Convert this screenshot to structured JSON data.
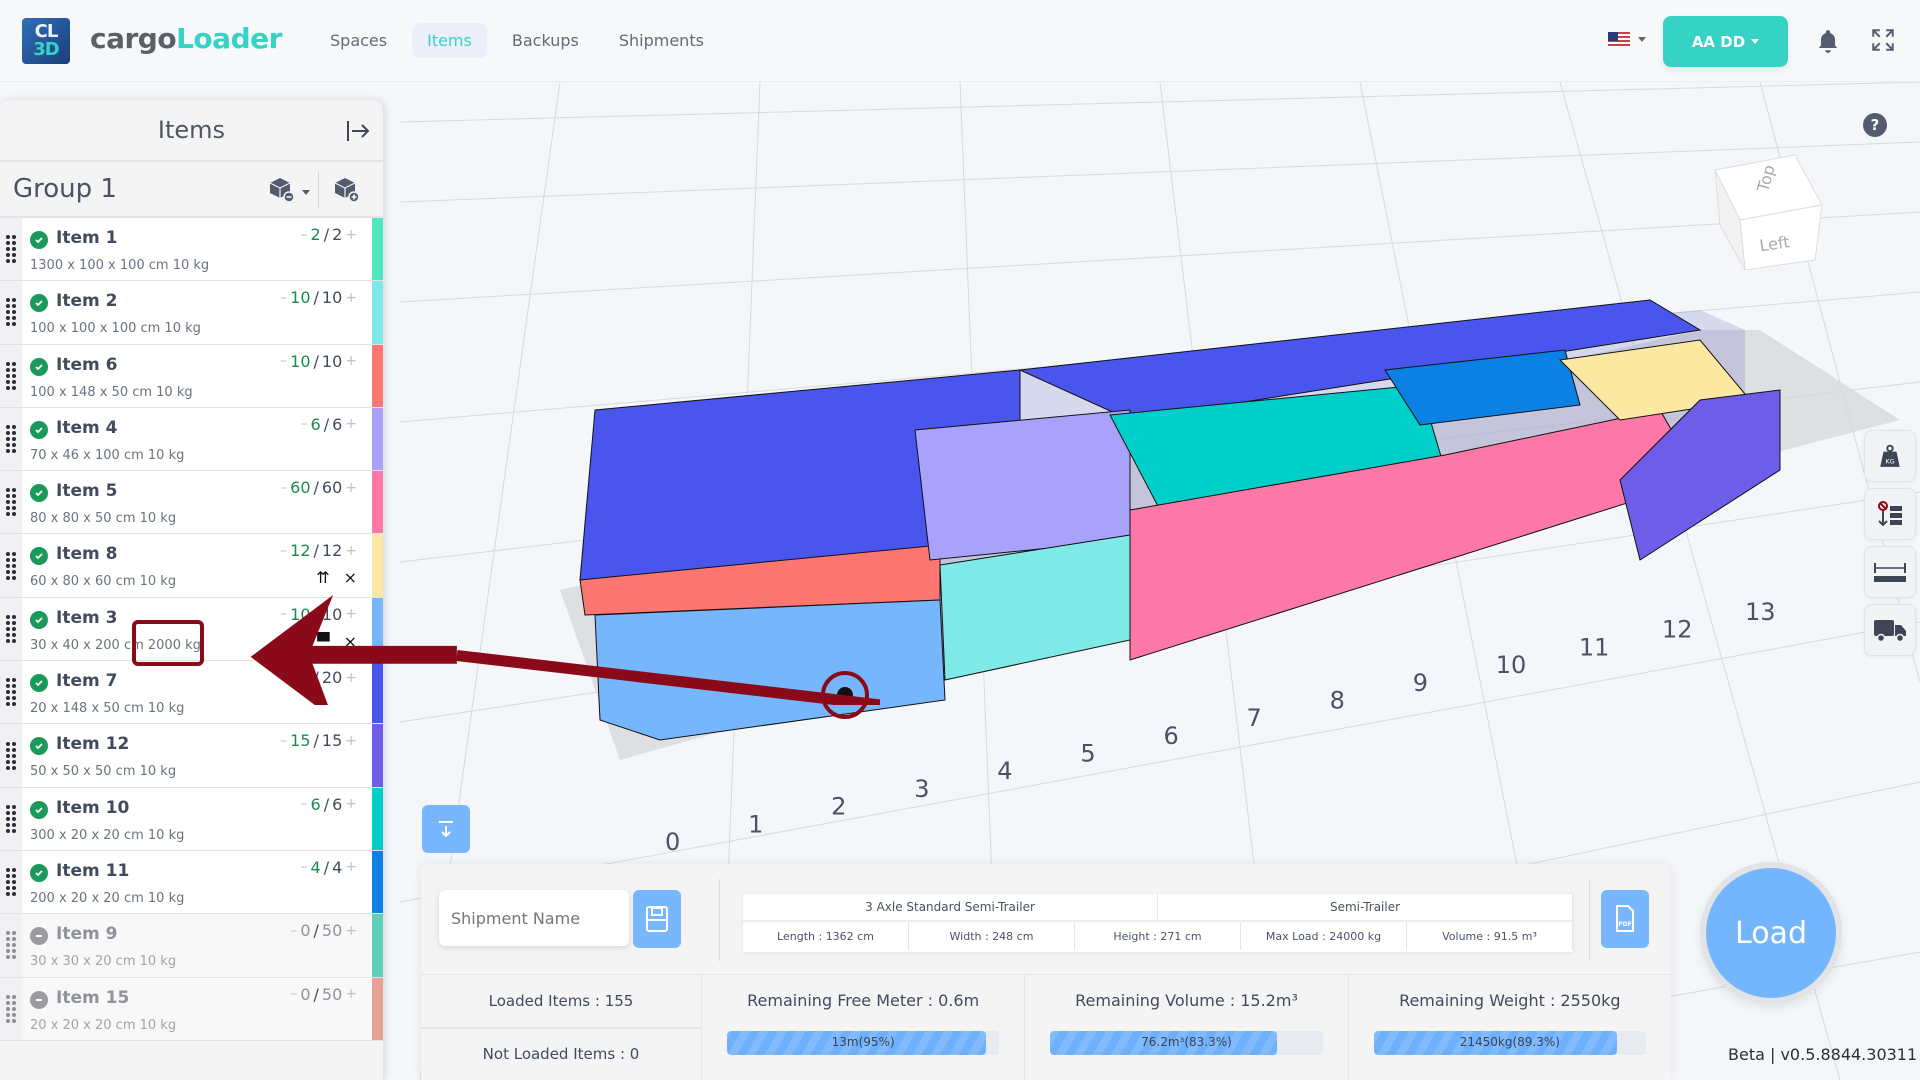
{
  "app": {
    "logo_line1": "CL",
    "logo_line2": "3D",
    "brand_part1": "cargo",
    "brand_part2": "Loader"
  },
  "nav": {
    "items": [
      {
        "label": "Spaces",
        "active": false
      },
      {
        "label": "Items",
        "active": true
      },
      {
        "label": "Backups",
        "active": false
      },
      {
        "label": "Shipments",
        "active": false
      }
    ]
  },
  "header": {
    "language": "en-US",
    "user_label": "AA DD"
  },
  "sidebar": {
    "title": "Items",
    "group_title": "Group 1",
    "items": [
      {
        "name": "Item 1",
        "dims": "1300 x 100 x 100 cm 10 kg",
        "loaded": "2",
        "total": "2",
        "status": "loaded",
        "color": "#4ee8be"
      },
      {
        "name": "Item 2",
        "dims": "100 x 100 x 100 cm 10 kg",
        "loaded": "10",
        "total": "10",
        "status": "loaded",
        "color": "#7ee9e7"
      },
      {
        "name": "Item 6",
        "dims": "100 x 148 x 50 cm 10 kg",
        "loaded": "10",
        "total": "10",
        "status": "loaded",
        "color": "#fd7671"
      },
      {
        "name": "Item 4",
        "dims": "70 x 46 x 100 cm 10 kg",
        "loaded": "6",
        "total": "6",
        "status": "loaded",
        "color": "#a9a2fb"
      },
      {
        "name": "Item 5",
        "dims": "80 x 80 x 50 cm 10 kg",
        "loaded": "60",
        "total": "60",
        "status": "loaded",
        "color": "#fd78a6"
      },
      {
        "name": "Item 8",
        "dims": "60 x 80 x 60 cm 10 kg",
        "loaded": "12",
        "total": "12",
        "status": "loaded",
        "color": "#fde8a2",
        "flags": [
          "this-side-up",
          "no-stack"
        ]
      },
      {
        "name": "Item 3",
        "dims": "30 x 40 x 200 cm 2000 kg",
        "loaded": "10",
        "total": "10",
        "status": "loaded",
        "color": "#76b6fd",
        "flags": [
          "this-side-up",
          "stack-weight",
          "no-stack"
        ]
      },
      {
        "name": "Item 7",
        "dims": "20 x 148 x 50 cm 10 kg",
        "loaded": "20",
        "total": "20",
        "status": "loaded",
        "color": "#4a55ee"
      },
      {
        "name": "Item 12",
        "dims": "50 x 50 x 50 cm 10 kg",
        "loaded": "15",
        "total": "15",
        "status": "loaded",
        "color": "#6d5de8"
      },
      {
        "name": "Item 10",
        "dims": "300 x 20 x 20 cm 10 kg",
        "loaded": "6",
        "total": "6",
        "status": "loaded",
        "color": "#00cfc9"
      },
      {
        "name": "Item 11",
        "dims": "200 x 20 x 20 cm 10 kg",
        "loaded": "4",
        "total": "4",
        "status": "loaded",
        "color": "#0b82e3"
      },
      {
        "name": "Item 9",
        "dims": "30 x 30 x 20 cm 10 kg",
        "loaded": "0",
        "total": "50",
        "status": "not-loaded",
        "color": "#5fd0b8"
      },
      {
        "name": "Item 15",
        "dims": "20 x 20 x 20 cm 10 kg",
        "loaded": "0",
        "total": "50",
        "status": "not-loaded",
        "color": "#e8a293"
      }
    ],
    "annotation": "2000 kg"
  },
  "scene": {
    "view_cube_top": "Top",
    "view_cube_side": "Left",
    "axis_labels": [
      "0",
      "1",
      "2",
      "3",
      "4",
      "5",
      "6",
      "7",
      "8",
      "9",
      "10",
      "11",
      "12",
      "13"
    ],
    "tools": [
      "weight-kg",
      "no-stack-layers",
      "measure",
      "truck"
    ]
  },
  "shipment": {
    "name_placeholder": "Shipment Name",
    "name_value": "",
    "vehicle_name": "3 Axle Standard Semi-Trailer",
    "vehicle_type": "Semi-Trailer",
    "specs": [
      "Length : 1362 cm",
      "Width : 248 cm",
      "Height : 271 cm",
      "Max Load : 24000 kg",
      "Volume : 91.5 m³"
    ],
    "loaded_items": "Loaded Items : 155",
    "not_loaded_items": "Not Loaded Items : 0",
    "remaining": [
      {
        "title": "Remaining Free Meter : 0.6m",
        "bar_label": "13m(95%)",
        "percent": 95
      },
      {
        "title": "Remaining Volume : 15.2m³",
        "bar_label": "76.2m³(83.3%)",
        "percent": 83.3
      },
      {
        "title": "Remaining Weight : 2550kg",
        "bar_label": "21450kg(89.3%)",
        "percent": 89.3
      }
    ]
  },
  "load_label": "Load",
  "version": "Beta | v0.5.8844.30311"
}
